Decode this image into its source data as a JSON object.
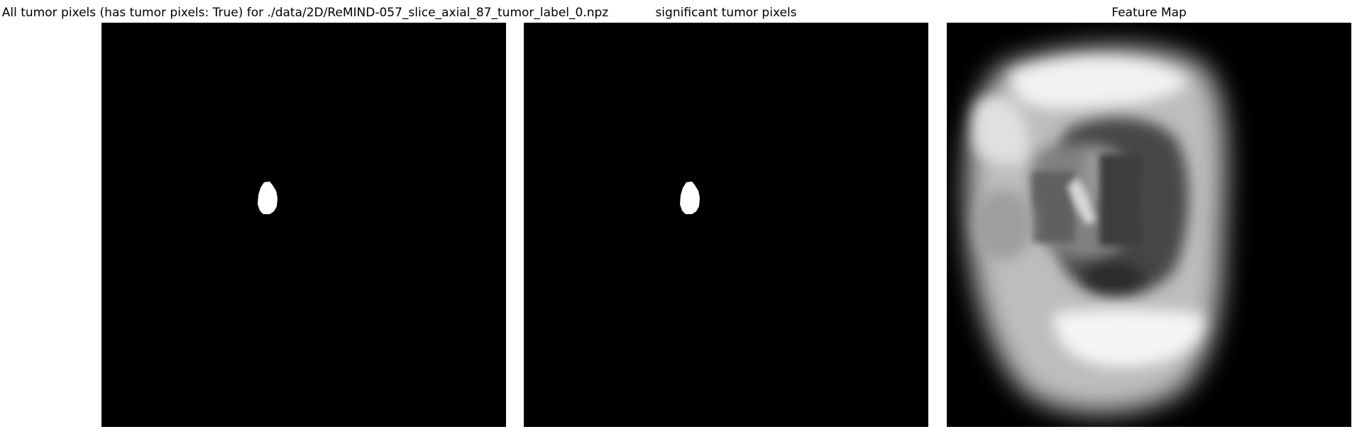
{
  "panels": [
    {
      "title": "All tumor pixels (has tumor pixels: True) for ./data/2D/ReMIND-057_slice_axial_87_tumor_label_0.npz",
      "kind": "binary-mask"
    },
    {
      "title": "significant tumor pixels",
      "kind": "binary-mask"
    },
    {
      "title": "Feature Map",
      "kind": "grayscale-feature-map"
    }
  ],
  "colors": {
    "background": "#ffffff",
    "image_background": "#000000",
    "mask_foreground": "#ffffff"
  }
}
